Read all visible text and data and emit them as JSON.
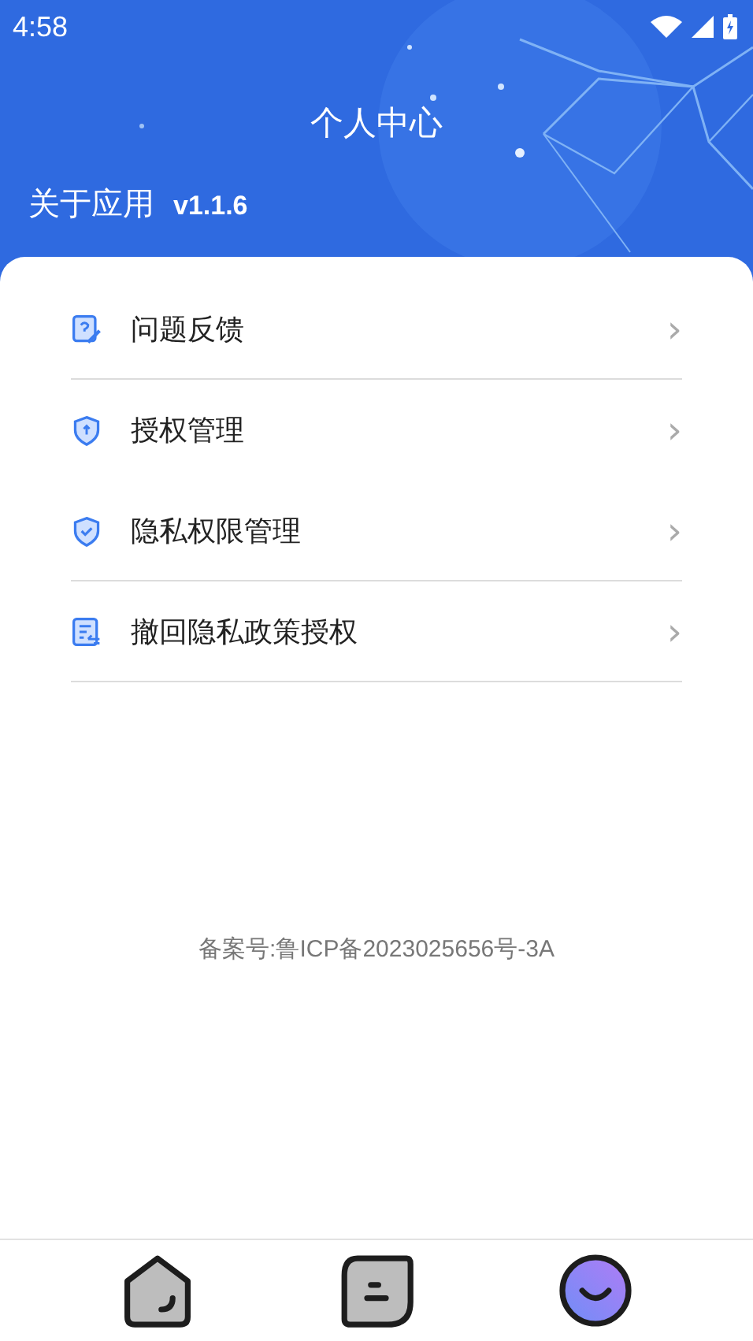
{
  "status_bar": {
    "time": "4:58"
  },
  "header": {
    "title": "个人中心",
    "about_label": "关于应用",
    "version": "v1.1.6"
  },
  "menu": [
    {
      "kind": "feedback",
      "label": "问题反馈",
      "chevron": "›",
      "divider": true
    },
    {
      "kind": "auth",
      "label": "授权管理",
      "chevron": "›",
      "divider": false
    },
    {
      "kind": "privacy",
      "label": "隐私权限管理",
      "chevron": "›",
      "divider": true
    },
    {
      "kind": "revoke",
      "label": "撤回隐私政策授权",
      "chevron": "›",
      "divider": true
    }
  ],
  "footer": {
    "icp": "备案号:鲁ICP备2023025656号-3A"
  },
  "tab_bar": [
    {
      "kind": "house",
      "selected": false
    },
    {
      "kind": "square",
      "selected": false
    },
    {
      "kind": "circle",
      "selected": true
    }
  ]
}
